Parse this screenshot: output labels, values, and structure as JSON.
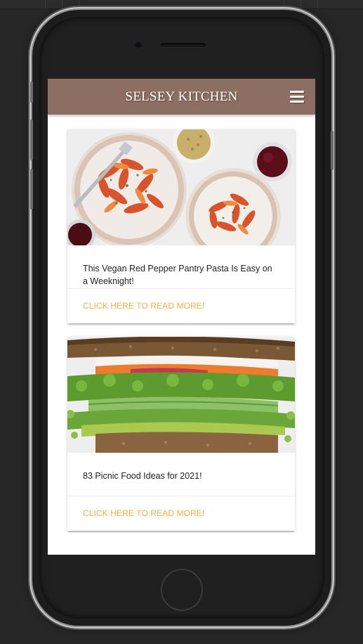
{
  "header": {
    "brand": "SELSEY KITCHEN",
    "menu_icon": "hamburger-menu-icon"
  },
  "colors": {
    "navbar": "#8d6e63",
    "link": "#ffab40"
  },
  "cards": [
    {
      "image": "red-pepper-pasta-plates",
      "title": "This Vegan Red Pepper Pantry Pasta Is Easy on a Weeknight!",
      "link_label": "CLICK HERE TO READ MORE!"
    },
    {
      "image": "veggie-sandwich-closeup",
      "title": "83 Picnic Food Ideas for 2021!",
      "link_label": "CLICK HERE TO READ MORE!"
    }
  ]
}
